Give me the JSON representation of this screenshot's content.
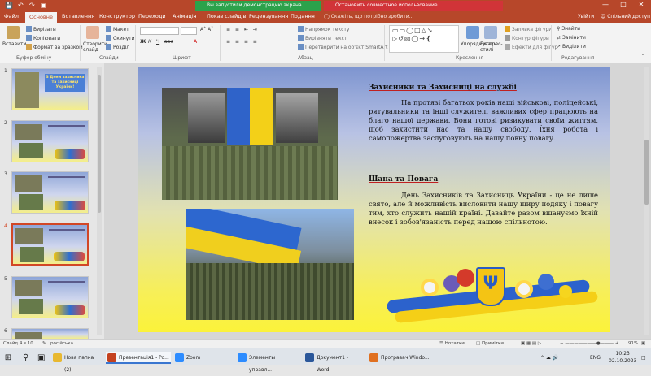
{
  "titlebar": {
    "presenting_banner": "Вы запустили демонстрацию экрана",
    "stop_sharing": "Остановить совместное использование"
  },
  "tabs": [
    "Файл",
    "Основне",
    "Вставлення",
    "Конструктор",
    "Переходи",
    "Анімація",
    "Показ слайдів",
    "Рецензування",
    "Подання"
  ],
  "tellme": "Скажіть, що потрібно зробити...",
  "account": {
    "user": "Увійти",
    "share": "Спільний доступ"
  },
  "ribbon": {
    "paste": "Вставити",
    "cut": "Вирізати",
    "copy": "Копіювати",
    "format_painter": "Формат за зразком",
    "clipboard": "Буфер обміну",
    "new_slide": "Створити слайд",
    "layout": "Макет",
    "reset": "Скинути",
    "section": "Розділ",
    "slides": "Слайди",
    "font": "Шрифт",
    "text_direction": "Напрямок тексту",
    "align_text": "Вирівняти текст",
    "convert_smartart": "Перетворити на об'єкт SmartArt",
    "paragraph": "Абзац",
    "arrange": "Упорядкувати",
    "quick_styles": "Експрес-стилі",
    "shape_fill": "Заливка фігури",
    "shape_outline": "Контур фігури",
    "shape_effects": "Ефекти для фігур",
    "drawing": "Креслення",
    "find": "Знайти",
    "replace": "Замінити",
    "select": "Виділити",
    "editing": "Редагування"
  },
  "thumbnails": [
    {
      "num": "1",
      "title": "З Днем захисника та захисниці України!"
    },
    {
      "num": "2"
    },
    {
      "num": "3"
    },
    {
      "num": "4"
    },
    {
      "num": "5"
    },
    {
      "num": "6"
    }
  ],
  "slide": {
    "heading1": "Захисники та Захисниці на службі",
    "para1": "На протязі багатьох років наші військові, поліцейські, рятувальники та інші служителі важливих сфер працюють на благо нашої держави. Вони готові ризикувати своїм життям, щоб захистити нас та нашу свободу. Їхня робота і самопожертва заслуговують на нашу повну повагу.",
    "heading2": "Шана та Повага",
    "para2": "День Захисників та Захисниць України - це не лише свято, але й можливість висловити нашу щиру подяку і повагу тим, хто служить нашій країні. Давайте разом вшануємо їхній внесок і зобов'язаність перед нашою спільнотою."
  },
  "status": {
    "slide_of": "Слайд 4 з 10",
    "language": "російська",
    "notes": "Нотатки",
    "comments": "Примітки",
    "zoom": "91%"
  },
  "taskbar": {
    "items": [
      "Нова папка (2)",
      "Презентація1 - Po...",
      "Zoom",
      "Элементы управл...",
      "Документ1 - Word",
      "Програвач Windo..."
    ],
    "lang": "ENG",
    "time": "10:23",
    "date": "02.10.2023"
  },
  "colors": {
    "accent": "#b7472a",
    "zoom_banner": "#2ca24b",
    "stop_banner": "#d13438"
  }
}
